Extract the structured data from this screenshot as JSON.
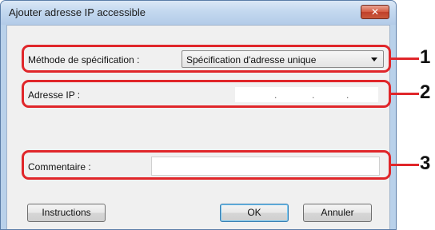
{
  "dialog": {
    "title": "Ajouter adresse IP accessible",
    "close_label": "✕"
  },
  "fields": {
    "method_label": "Méthode de spécification :",
    "method_value": "Spécification d'adresse unique",
    "ip_label": "Adresse IP :",
    "ip_dots": [
      ".",
      ".",
      "."
    ],
    "comment_label": "Commentaire :",
    "comment_value": ""
  },
  "buttons": {
    "instructions": "Instructions",
    "ok": "OK",
    "cancel": "Annuler"
  },
  "callouts": [
    "1",
    "2",
    "3"
  ],
  "colors": {
    "highlight": "#e0262a",
    "title_bar": "#c3d8ef",
    "close_button": "#c9593c"
  }
}
